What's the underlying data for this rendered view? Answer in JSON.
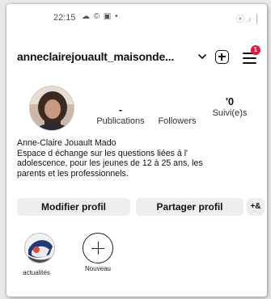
{
  "status_bar": {
    "time": "22:15",
    "system_icons": "☁ © ▣ •",
    "right_icons": "⦿ .ı▕"
  },
  "header": {
    "username": "anneclairejouault_maisonde...",
    "notification_count": "1"
  },
  "stats": {
    "publications": {
      "count": "-",
      "label": "Publications"
    },
    "followers": {
      "count": "",
      "label": "Followers"
    },
    "following": {
      "count": "'0",
      "label": "Suivi(e)s"
    }
  },
  "bio": {
    "name": "Anne-Claire Jouault Mado",
    "line1": "Espace d échange sur les questions liées à l'",
    "line2": "adolescence, pour  les jeunes de 12 à 25 ans, les",
    "line3": "parents et les professionnels."
  },
  "buttons": {
    "edit_profile": "Modifier profil",
    "share_profile": "Partager profil",
    "add_person": "+&"
  },
  "highlights": [
    {
      "label": "actualités"
    },
    {
      "label": "Nouveau"
    }
  ],
  "colors": {
    "badge": "#e8143a",
    "button_bg": "#ededed"
  }
}
